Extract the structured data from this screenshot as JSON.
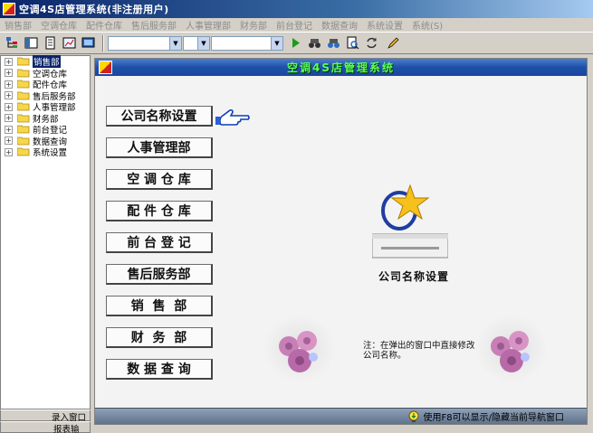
{
  "app": {
    "title": "空调4S店管理系统(非注册用户)"
  },
  "menu": [
    "销售部",
    "空调仓库",
    "配件仓库",
    "售后服务部",
    "人事管理部",
    "财务部",
    "前台登记",
    "数据查询",
    "系统设置",
    "系统(S)"
  ],
  "tree": {
    "items": [
      {
        "label": "销售部",
        "selected": true
      },
      {
        "label": "空调仓库"
      },
      {
        "label": "配件仓库"
      },
      {
        "label": "售后服务部"
      },
      {
        "label": "人事管理部"
      },
      {
        "label": "财务部"
      },
      {
        "label": "前台登记"
      },
      {
        "label": "数据查询"
      },
      {
        "label": "系统设置"
      }
    ]
  },
  "bottom_left": {
    "line1": "录入窗口",
    "line2": "报表输出"
  },
  "inner": {
    "title": "空调4S店管理系统",
    "buttons": [
      "公司名称设置",
      "人事管理部",
      "空 调 仓 库",
      "配 件 仓 库",
      "前 台 登 记",
      "售后服务部",
      "销  售  部",
      "财  务  部",
      "数 据 查 询"
    ],
    "logo_caption": "公司名称设置",
    "note": "注：在弹出的窗口中直接修改公司名称。",
    "status": "使用F8可以显示/隐藏当前导航窗口"
  },
  "colors": {
    "title_bg": "#0a246a",
    "inner_title_text": "#5cff5c",
    "status_bg": "#6f839b"
  }
}
